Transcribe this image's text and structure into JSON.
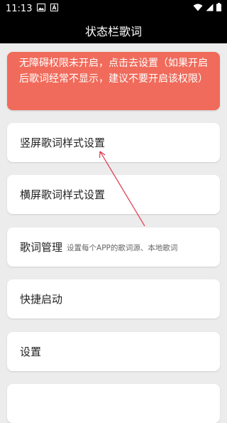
{
  "statusbar": {
    "time": "11:13",
    "icons": [
      "image-icon",
      "a-notification-icon",
      "wifi-icon",
      "signal-icon",
      "battery-icon"
    ]
  },
  "appbar": {
    "title": "状态栏歌词"
  },
  "warning": {
    "text": "无障碍权限未开启，点击去设置（如果开启后歌词经常不显示，建议不要开启该权限）",
    "color": "#f06b5b"
  },
  "menu": {
    "items": [
      {
        "label": "竖屏歌词样式设置",
        "sub": ""
      },
      {
        "label": "横屏歌词样式设置",
        "sub": ""
      },
      {
        "label": "歌词管理",
        "sub": "设置每个APP的歌词源、本地歌词"
      },
      {
        "label": "快捷启动",
        "sub": ""
      },
      {
        "label": "设置",
        "sub": ""
      },
      {
        "label": "",
        "sub": ""
      }
    ]
  },
  "annotation": {
    "arrow_color": "#e0314a"
  }
}
